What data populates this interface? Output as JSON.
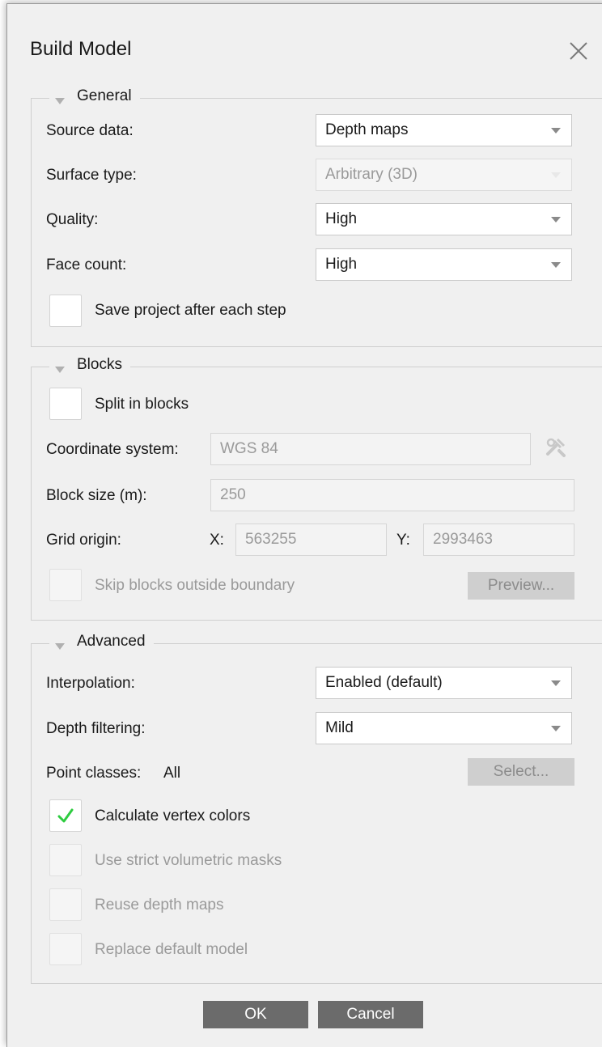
{
  "dialog": {
    "title": "Build Model"
  },
  "general": {
    "legend": "General",
    "source_data": {
      "label": "Source data:",
      "value": "Depth maps"
    },
    "surface_type": {
      "label": "Surface type:",
      "value": "Arbitrary (3D)"
    },
    "quality": {
      "label": "Quality:",
      "value": "High"
    },
    "face_count": {
      "label": "Face count:",
      "value": "High"
    },
    "save_project": {
      "label": "Save project after each step",
      "checked": false
    }
  },
  "blocks": {
    "legend": "Blocks",
    "split": {
      "label": "Split in blocks",
      "checked": false
    },
    "coordinate_system": {
      "label": "Coordinate system:",
      "value": "WGS 84"
    },
    "block_size": {
      "label": "Block size (m):",
      "value": "250"
    },
    "grid_origin": {
      "label": "Grid origin:",
      "x_label": "X:",
      "x_value": "563255",
      "y_label": "Y:",
      "y_value": "2993463"
    },
    "skip_blocks": {
      "label": "Skip blocks outside boundary",
      "checked": false
    },
    "preview_button": "Preview..."
  },
  "advanced": {
    "legend": "Advanced",
    "interpolation": {
      "label": "Interpolation:",
      "value": "Enabled (default)"
    },
    "depth_filtering": {
      "label": "Depth filtering:",
      "value": "Mild"
    },
    "point_classes": {
      "label": "Point classes:",
      "value": "All"
    },
    "select_button": "Select...",
    "calculate_vertex_colors": {
      "label": "Calculate vertex colors",
      "checked": true
    },
    "strict_volumetric_masks": {
      "label": "Use strict volumetric masks",
      "checked": false
    },
    "reuse_depth_maps": {
      "label": "Reuse depth maps",
      "checked": false
    },
    "replace_default_model": {
      "label": "Replace default model",
      "checked": false
    }
  },
  "footer": {
    "ok": "OK",
    "cancel": "Cancel"
  },
  "colors": {
    "check_green": "#2ecc40",
    "dialog_bg": "#f0f0f0",
    "primary_button": "#6b6b6b"
  }
}
